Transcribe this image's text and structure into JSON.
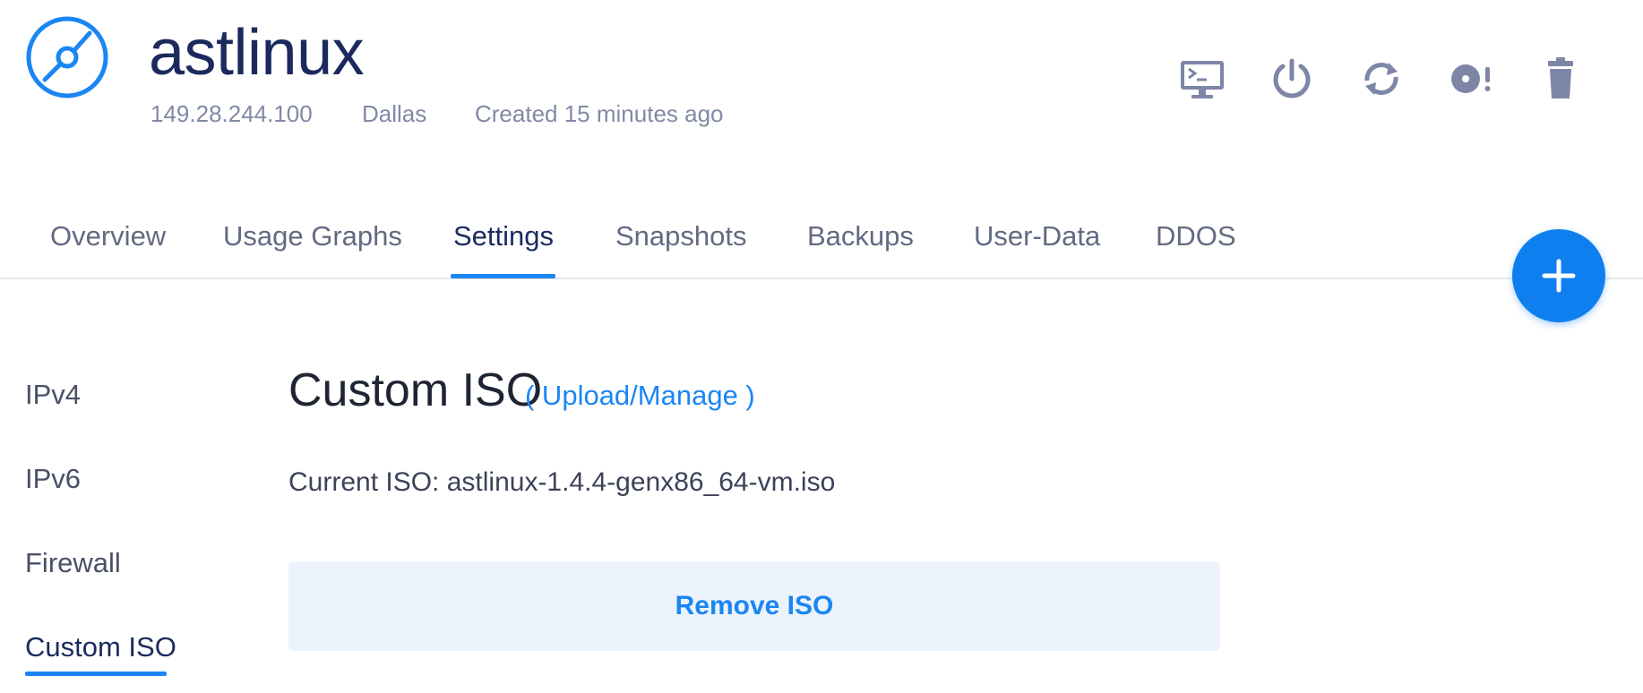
{
  "server": {
    "name": "astlinux",
    "ip": "149.28.244.100",
    "location": "Dallas",
    "created": "Created 15 minutes ago",
    "logo_icon": "disc-icon"
  },
  "actions": [
    {
      "icon": "console-icon",
      "label": "View Console"
    },
    {
      "icon": "power-icon",
      "label": "Server Stop"
    },
    {
      "icon": "restart-icon",
      "label": "Server Restart"
    },
    {
      "icon": "reinstall-icon",
      "label": "Server Reinstall"
    },
    {
      "icon": "trash-icon",
      "label": "Server Destroy"
    }
  ],
  "tabs": [
    {
      "label": "Overview",
      "active": false
    },
    {
      "label": "Usage Graphs",
      "active": false
    },
    {
      "label": "Settings",
      "active": true
    },
    {
      "label": "Snapshots",
      "active": false
    },
    {
      "label": "Backups",
      "active": false
    },
    {
      "label": "User-Data",
      "active": false
    },
    {
      "label": "DDOS",
      "active": false
    }
  ],
  "fab": {
    "icon": "plus-icon"
  },
  "settings_nav": [
    {
      "label": "IPv4",
      "active": false
    },
    {
      "label": "IPv6",
      "active": false
    },
    {
      "label": "Firewall",
      "active": false
    },
    {
      "label": "Custom ISO",
      "active": true
    }
  ],
  "content": {
    "title": "Custom ISO",
    "manage_link": "( Upload/Manage )",
    "current_iso": "Current ISO: astlinux-1.4.4-genx86_64-vm.iso",
    "remove_button": "Remove ISO"
  },
  "colors": {
    "accent": "#1b86f3",
    "title": "#1b2a5e",
    "muted": "#8189a6",
    "icon": "#7d86a6",
    "button_bg": "#ecf3fd"
  }
}
